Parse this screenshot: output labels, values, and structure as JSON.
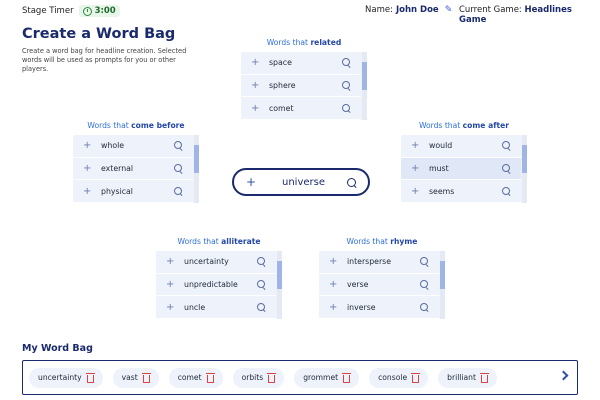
{
  "header": {
    "stage_timer_label": "Stage Timer",
    "timer_value": "3:00",
    "name_label": "Name:",
    "name_value": "John Doe",
    "game_label": "Current Game:",
    "game_value": "Headlines Game"
  },
  "page": {
    "title": "Create a Word Bag",
    "description": "Create a word bag for headline creation. Selected words will be used as prompts for you or other players."
  },
  "center": {
    "word": "universe"
  },
  "groups": {
    "related": {
      "prefix": "Words that ",
      "keyword": "related",
      "words": [
        "space",
        "sphere",
        "comet"
      ]
    },
    "come_before": {
      "prefix": "Words that ",
      "keyword": "come before",
      "words": [
        "whole",
        "external",
        "physical"
      ]
    },
    "come_after": {
      "prefix": "Words that ",
      "keyword": "come after",
      "words": [
        "would",
        "must",
        "seems"
      ]
    },
    "alliterate": {
      "prefix": "Words that ",
      "keyword": "alliterate",
      "words": [
        "uncertainty",
        "unpredictable",
        "uncle"
      ]
    },
    "rhyme": {
      "prefix": "Words that ",
      "keyword": "rhyme",
      "words": [
        "intersperse",
        "verse",
        "inverse"
      ]
    }
  },
  "bag": {
    "title": "My Word Bag",
    "items": [
      "uncertainty",
      "vast",
      "comet",
      "orbits",
      "grommet",
      "console",
      "brilliant"
    ]
  },
  "colors": {
    "primary_navy": "#1a2a6c",
    "link_blue": "#2f6fd6",
    "list_bg": "#eef2fb",
    "delete_red": "#d9433a",
    "timer_green": "#2e8b3d"
  },
  "icons": [
    "timer-icon",
    "pencil-icon",
    "plus-icon",
    "search-icon",
    "trash-icon",
    "chevron-right-icon"
  ]
}
